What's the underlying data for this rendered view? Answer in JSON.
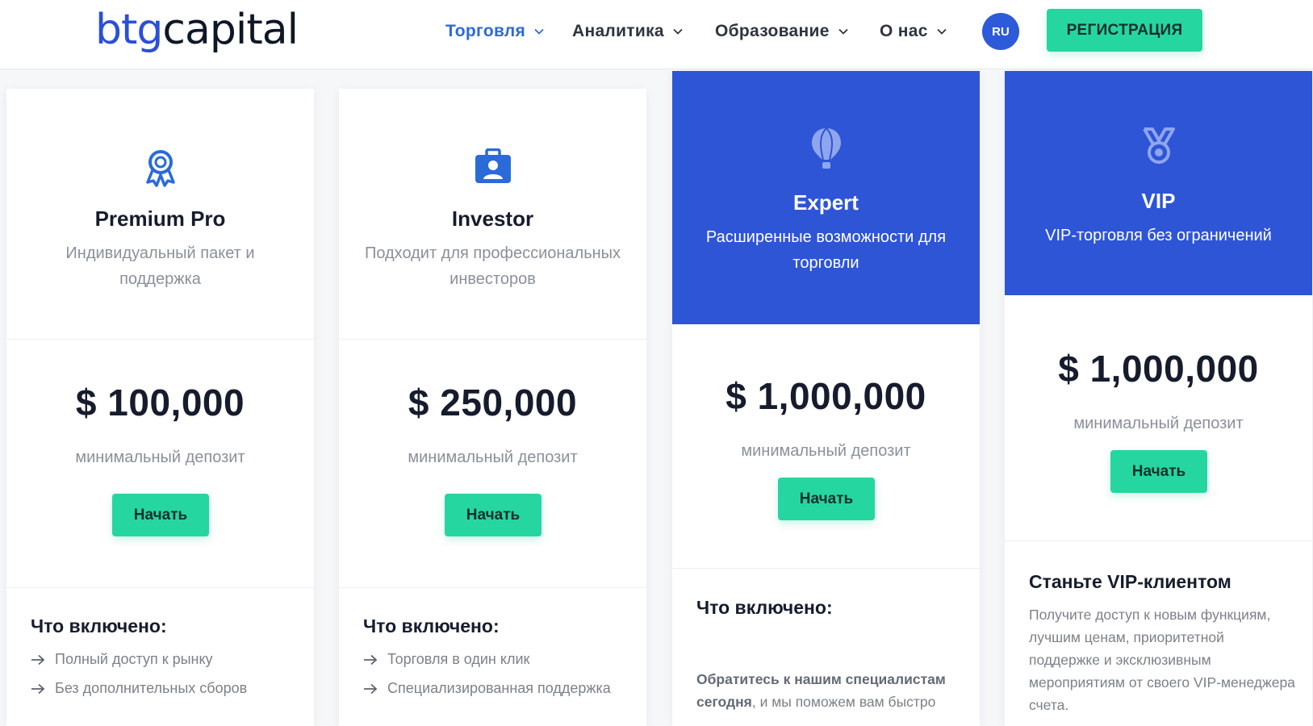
{
  "logo": {
    "part1": "btg",
    "part2": "capital"
  },
  "nav": [
    {
      "label": "Торговля"
    },
    {
      "label": "Аналитика"
    },
    {
      "label": "Образование"
    },
    {
      "label": "О нас"
    }
  ],
  "lang": "RU",
  "register_label": "РЕГИСТРАЦИЯ",
  "plans": [
    {
      "name": "Premium Pro",
      "icon": "award-icon",
      "subtitle": "Индивидуальный пакет и поддержка",
      "price": "$ 100,000",
      "deposit_label": "минимальный депозит",
      "cta": "Начать",
      "included_title": "Что включено:",
      "features": [
        "Полный доступ к рынку",
        "Без дополнительных сборов"
      ]
    },
    {
      "name": "Investor",
      "icon": "briefcase-user-icon",
      "subtitle": "Подходит для профессиональных инвесторов",
      "price": "$ 250,000",
      "deposit_label": "минимальный депозит",
      "cta": "Начать",
      "included_title": "Что включено:",
      "features": [
        "Торговля в один клик",
        "Специализированная поддержка"
      ]
    },
    {
      "name": "Expert",
      "icon": "hot-air-balloon-icon",
      "subtitle": "Расширенные возможности для торговли",
      "price": "$ 1,000,000",
      "deposit_label": "минимальный депозит",
      "cta": "Начать",
      "included_title": "Что включено:",
      "paragraph_bold": "Обратитесь к нашим специалистам сегодня",
      "paragraph_rest": ", и мы поможем вам быстро"
    },
    {
      "name": "VIP",
      "icon": "medal-icon",
      "subtitle": "VIP-торговля без ограничений",
      "price": "$ 1,000,000",
      "deposit_label": "минимальный депозит",
      "cta": "Начать",
      "included_title": "Станьте VIP-клиентом",
      "paragraph": "Получите доступ к новым функциям, лучшим ценам, приоритетной поддержке и эксклюзивным мероприятиям от своего VIP-менеджера счета."
    }
  ],
  "colors": {
    "brand_blue": "#2e55d6",
    "accent_green": "#25d6a1",
    "nav_active": "#2b6ad9"
  }
}
